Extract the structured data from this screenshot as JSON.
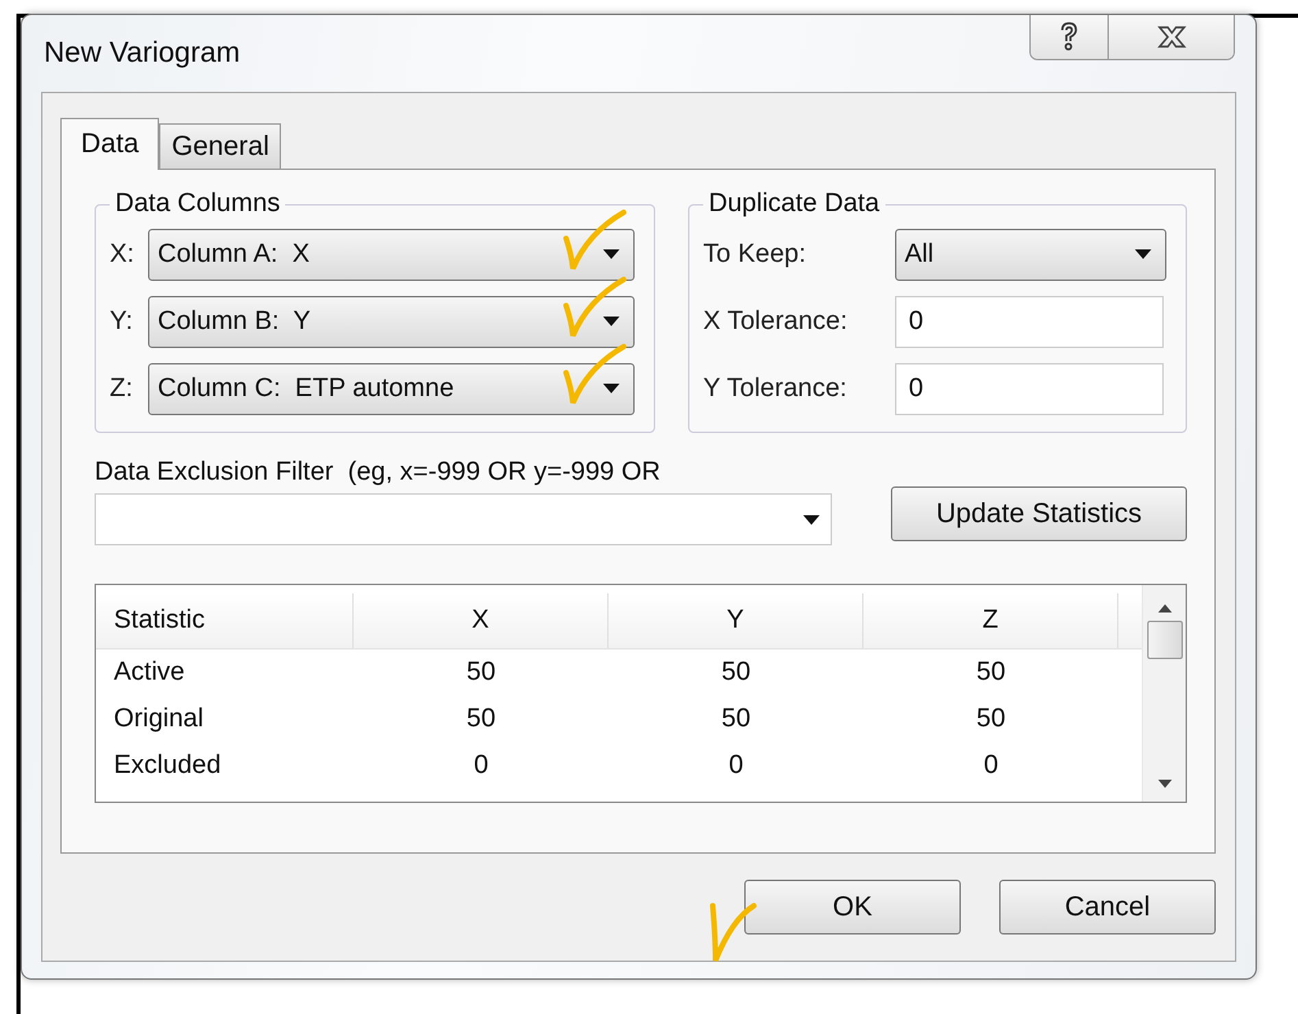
{
  "window": {
    "title": "New Variogram"
  },
  "tabs": [
    {
      "label": "Data",
      "selected": true
    },
    {
      "label": "General",
      "selected": false
    }
  ],
  "data_columns": {
    "title": "Data Columns",
    "fields": [
      {
        "label": "X:",
        "value": "Column A:  X"
      },
      {
        "label": "Y:",
        "value": "Column B:  Y"
      },
      {
        "label": "Z:",
        "value": "Column C:  ETP automne"
      }
    ]
  },
  "duplicate_data": {
    "title": "Duplicate Data",
    "fields": [
      {
        "kind": "dropdown",
        "label": "To Keep:",
        "value": "All"
      },
      {
        "kind": "input",
        "label": "X Tolerance:",
        "value": "0"
      },
      {
        "kind": "input",
        "label": "Y Tolerance:",
        "value": "0"
      }
    ]
  },
  "filter": {
    "label": "Data Exclusion Filter  (eg, x=-999 OR y=-999 OR"
  },
  "update_button": "Update Statistics",
  "table": {
    "columns": [
      "Statistic",
      "X",
      "Y",
      "Z"
    ],
    "rows": [
      [
        "Active",
        "50",
        "50",
        "50"
      ],
      [
        "Original",
        "50",
        "50",
        "50"
      ],
      [
        "Excluded",
        "0",
        "0",
        "0"
      ]
    ]
  },
  "buttons": [
    "OK",
    "Cancel"
  ]
}
